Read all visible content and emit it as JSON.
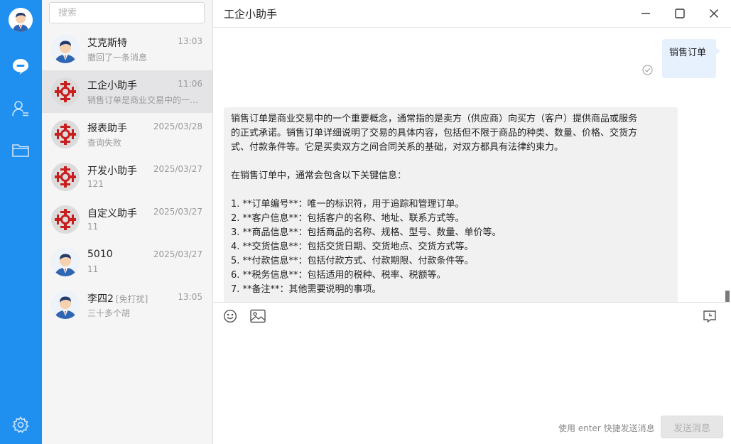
{
  "colors": {
    "rail": "#1f8ff0",
    "list_bg": "#f5f5f6",
    "active_item": "#e4e4e6",
    "out_bubble": "#e6f1fd",
    "in_bubble": "#f1f1f1"
  },
  "rail": {
    "icons": [
      "user-avatar",
      "chat-icon",
      "contacts-icon",
      "folder-icon",
      "settings-icon"
    ]
  },
  "search": {
    "placeholder": "搜索"
  },
  "conversations": [
    {
      "name": "艾克斯特",
      "tag": "",
      "time": "13:03",
      "preview": "撤回了一条消息",
      "avatar": "person"
    },
    {
      "name": "工企小助手",
      "tag": "",
      "time": "11:06",
      "preview": "销售订单是商业交易中的一个重要概念...",
      "avatar": "bot",
      "active": true
    },
    {
      "name": "报表助手",
      "tag": "",
      "time": "2025/03/28",
      "preview": "查询失败",
      "avatar": "bot"
    },
    {
      "name": "开发小助手",
      "tag": "",
      "time": "2025/03/27",
      "preview": "121",
      "avatar": "bot"
    },
    {
      "name": "自定义助手",
      "tag": "",
      "time": "2025/03/27",
      "preview": "11",
      "avatar": "bot"
    },
    {
      "name": "5010",
      "tag": "",
      "time": "2025/03/27",
      "preview": "11",
      "avatar": "person"
    },
    {
      "name": "李四2",
      "tag": "[免打扰]",
      "time": "13:05",
      "preview": "三十多个胡",
      "avatar": "person"
    }
  ],
  "chat": {
    "title": "工企小助手",
    "outgoing": "销售订单",
    "incoming": [
      "销售订单是商业交易中的一个重要概念，通常指的是卖方（供应商）向买方（客户）提供商品或服务",
      "的正式承诺。销售订单详细说明了交易的具体内容，包括但不限于商品的种类、数量、价格、交货方",
      "式、付款条件等。它是买卖双方之间合同关系的基础，对双方都具有法律约束力。",
      "",
      "在销售订单中，通常会包含以下关键信息：",
      "",
      "1. **订单编号**：唯一的标识符，用于追踪和管理订单。",
      "2. **客户信息**：包括客户的名称、地址、联系方式等。",
      "3. **商品信息**：包括商品的名称、规格、型号、数量、单价等。",
      "4. **交货信息**：包括交货日期、交货地点、交货方式等。",
      "5. **付款信息**：包括付款方式、付款期限、付款条件等。",
      "6. **税务信息**：包括适用的税种、税率、税额等。",
      "7. **备注**：其他需要说明的事项。"
    ]
  },
  "composer": {
    "hint": "使用 enter 快捷发送消息",
    "send_label": "发送消息"
  }
}
